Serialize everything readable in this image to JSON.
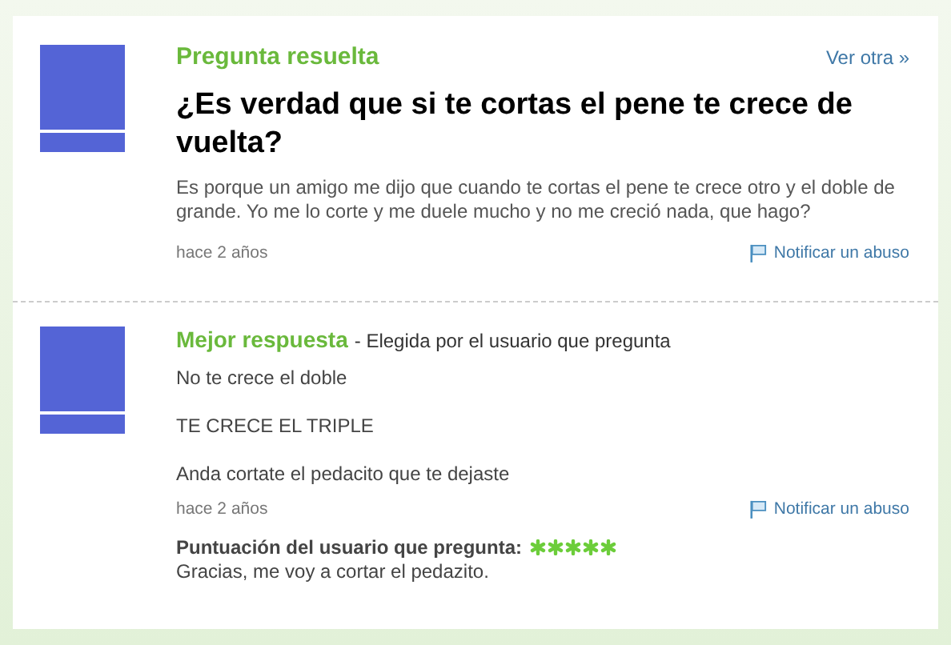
{
  "question": {
    "status": "Pregunta resuelta",
    "next_link": "Ver otra »",
    "title": "¿Es verdad que si te cortas el pene te crece de vuelta?",
    "body": "Es porque un amigo me dijo que cuando te cortas el pene te crece otro y el doble de grande. Yo me lo corte y me duele mucho y no me creció nada, que hago?",
    "time": "hace 2 años",
    "report": "Notificar un abuso"
  },
  "best_answer": {
    "label": "Mejor respuesta",
    "chosen_by": "- Elegida por el usuario que pregunta",
    "paragraphs": [
      "No te crece el doble",
      "TE CRECE EL TRIPLE",
      "Anda cortate el pedacito que te dejaste"
    ],
    "time": "hace 2 años",
    "report": "Notificar un abuso",
    "rating": {
      "label": "Puntuación del usuario que pregunta:",
      "stars": 5
    },
    "comment": "Gracias, me voy a cortar el pedazito."
  }
}
